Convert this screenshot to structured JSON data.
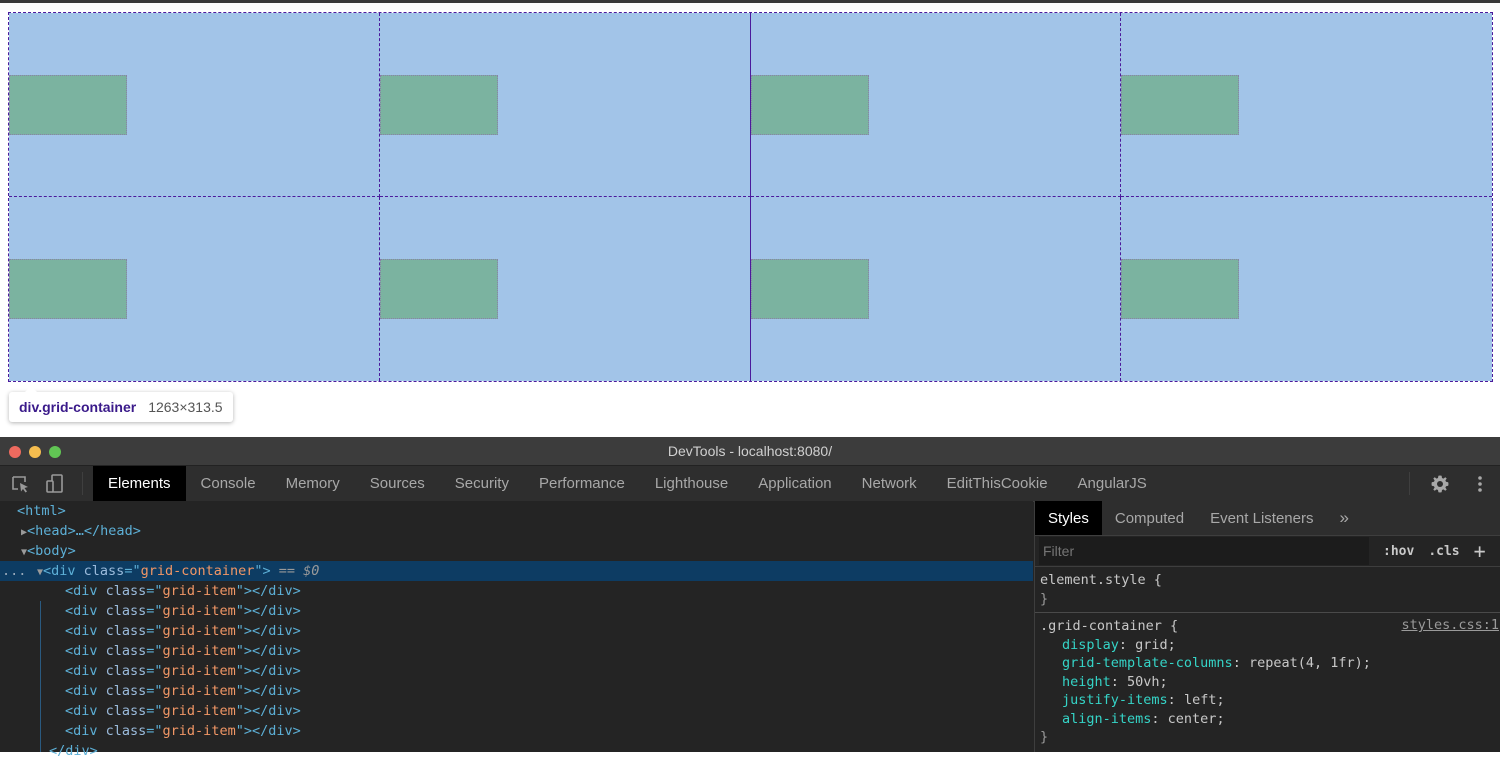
{
  "overlay": {
    "element_label": "div.grid-container",
    "element_size": "1263×313.5",
    "colors": {
      "container": "#a2c4e8",
      "item": "#7bb3a0",
      "grid_lines": "#4b1a9c"
    },
    "grid": {
      "columns": 4,
      "rows": 2,
      "items": 8
    }
  },
  "window": {
    "title": "DevTools - localhost:8080/",
    "traffic_lights": [
      "#ee6a5f",
      "#f5bd4f",
      "#61c554"
    ]
  },
  "toolbar": {
    "inspect_icon": "inspect-element-icon",
    "device_icon": "device-toggle-icon",
    "tabs": [
      "Elements",
      "Console",
      "Memory",
      "Sources",
      "Security",
      "Performance",
      "Lighthouse",
      "Application",
      "Network",
      "EditThisCookie",
      "AngularJS"
    ],
    "active_tab": "Elements",
    "settings_icon": "gear-icon",
    "menu_icon": "kebab-menu-icon"
  },
  "dom": {
    "html": "<html>",
    "head": "<head>…</head>",
    "body": "<body>",
    "selected": {
      "open": "<div ",
      "attr": "class",
      "eq": "=\"",
      "val": "grid-container",
      "close": "\">",
      "marker": " == $0"
    },
    "ellipsis": "...",
    "children": [
      {
        "open": "<div ",
        "attr": "class",
        "val": "grid-item",
        "close": "\"></div>"
      },
      {
        "open": "<div ",
        "attr": "class",
        "val": "grid-item",
        "close": "\"></div>"
      },
      {
        "open": "<div ",
        "attr": "class",
        "val": "grid-item",
        "close": "\"></div>"
      },
      {
        "open": "<div ",
        "attr": "class",
        "val": "grid-item",
        "close": "\"></div>"
      },
      {
        "open": "<div ",
        "attr": "class",
        "val": "grid-item",
        "close": "\"></div>"
      },
      {
        "open": "<div ",
        "attr": "class",
        "val": "grid-item",
        "close": "\"></div>"
      },
      {
        "open": "<div ",
        "attr": "class",
        "val": "grid-item",
        "close": "\"></div>"
      },
      {
        "open": "<div ",
        "attr": "class",
        "val": "grid-item",
        "close": "\"></div>"
      }
    ],
    "closing": "</div>"
  },
  "styles_pane": {
    "tabs": [
      "Styles",
      "Computed",
      "Event Listeners"
    ],
    "active_tab": "Styles",
    "more": "»",
    "filter_placeholder": "Filter",
    "hov": ":hov",
    "cls": ".cls",
    "add": "+",
    "element_style": {
      "selector": "element.style {",
      "close": "}"
    },
    "rule": {
      "selector": ".grid-container {",
      "source": "styles.css:1",
      "declarations": [
        {
          "prop": "display",
          "value": "grid;"
        },
        {
          "prop": "grid-template-columns",
          "value": "repeat(4, 1fr);"
        },
        {
          "prop": "height",
          "value": "50vh;"
        },
        {
          "prop": "justify-items",
          "value": "left;"
        },
        {
          "prop": "align-items",
          "value": "center;"
        }
      ],
      "close": "}"
    }
  }
}
